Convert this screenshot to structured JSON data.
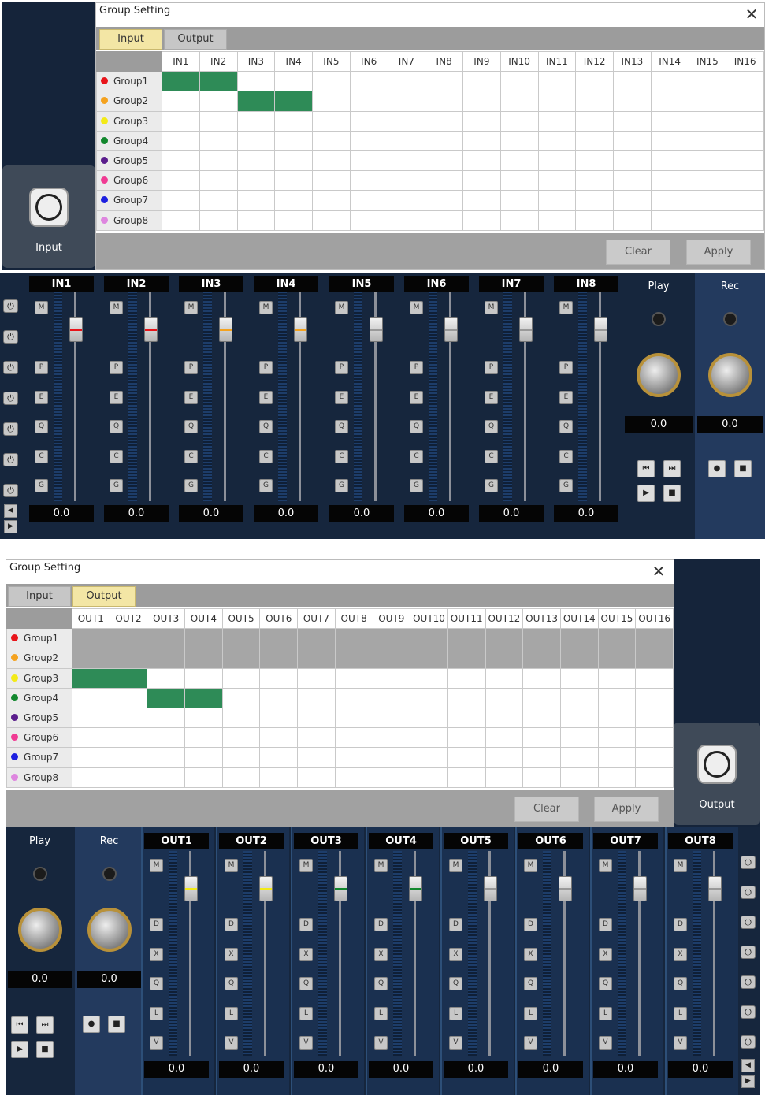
{
  "top": {
    "title": "Group Setting",
    "tabs": [
      "Input",
      "Output"
    ],
    "columns": [
      "IN1",
      "IN2",
      "IN3",
      "IN4",
      "IN5",
      "IN6",
      "IN7",
      "IN8",
      "IN9",
      "IN10",
      "IN11",
      "IN12",
      "IN13",
      "IN14",
      "IN15",
      "IN16"
    ],
    "groups": [
      {
        "name": "Group1",
        "color": "#e8141a"
      },
      {
        "name": "Group2",
        "color": "#f4a21f"
      },
      {
        "name": "Group3",
        "color": "#f3ea17"
      },
      {
        "name": "Group4",
        "color": "#12872d"
      },
      {
        "name": "Group5",
        "color": "#5a1d8c"
      },
      {
        "name": "Group6",
        "color": "#f03b93"
      },
      {
        "name": "Group7",
        "color": "#1d20e0"
      },
      {
        "name": "Group8",
        "color": "#de86df"
      }
    ],
    "active_cells": [
      [
        0,
        0
      ],
      [
        0,
        1
      ],
      [
        1,
        2
      ],
      [
        1,
        3
      ]
    ],
    "clear_label": "Clear",
    "apply_label": "Apply",
    "side_label": "Input",
    "strips": [
      {
        "name": "IN1",
        "value": "0.0",
        "marker": "#e8141a"
      },
      {
        "name": "IN2",
        "value": "0.0",
        "marker": "#e8141a"
      },
      {
        "name": "IN3",
        "value": "0.0",
        "marker": "#f4a21f"
      },
      {
        "name": "IN4",
        "value": "0.0",
        "marker": "#f4a21f"
      },
      {
        "name": "IN5",
        "value": "0.0",
        "marker": ""
      },
      {
        "name": "IN6",
        "value": "0.0",
        "marker": ""
      },
      {
        "name": "IN7",
        "value": "0.0",
        "marker": ""
      },
      {
        "name": "IN8",
        "value": "0.0",
        "marker": ""
      }
    ],
    "strip_buttons": [
      "M",
      "P",
      "E",
      "Q",
      "C",
      "G"
    ],
    "play": {
      "title": "Play",
      "value": "0.0"
    },
    "rec": {
      "title": "Rec",
      "value": "0.0"
    }
  },
  "bottom": {
    "title": "Group Setting",
    "tabs": [
      "Input",
      "Output"
    ],
    "columns": [
      "OUT1",
      "OUT2",
      "OUT3",
      "OUT4",
      "OUT5",
      "OUT6",
      "OUT7",
      "OUT8",
      "OUT9",
      "OUT10",
      "OUT11",
      "OUT12",
      "OUT13",
      "OUT14",
      "OUT15",
      "OUT16"
    ],
    "groups": [
      {
        "name": "Group1",
        "color": "#e8141a"
      },
      {
        "name": "Group2",
        "color": "#f4a21f"
      },
      {
        "name": "Group3",
        "color": "#f3ea17"
      },
      {
        "name": "Group4",
        "color": "#12872d"
      },
      {
        "name": "Group5",
        "color": "#5a1d8c"
      },
      {
        "name": "Group6",
        "color": "#f03b93"
      },
      {
        "name": "Group7",
        "color": "#1d20e0"
      },
      {
        "name": "Group8",
        "color": "#de86df"
      }
    ],
    "active_cells": [
      [
        2,
        0
      ],
      [
        2,
        1
      ],
      [
        3,
        2
      ],
      [
        3,
        3
      ]
    ],
    "disabled_rows": [
      0,
      1
    ],
    "clear_label": "Clear",
    "apply_label": "Apply",
    "side_label": "Output",
    "strips": [
      {
        "name": "OUT1",
        "value": "0.0",
        "marker": "#f3ea17"
      },
      {
        "name": "OUT2",
        "value": "0.0",
        "marker": "#f3ea17"
      },
      {
        "name": "OUT3",
        "value": "0.0",
        "marker": "#12872d"
      },
      {
        "name": "OUT4",
        "value": "0.0",
        "marker": "#12872d"
      },
      {
        "name": "OUT5",
        "value": "0.0",
        "marker": ""
      },
      {
        "name": "OUT6",
        "value": "0.0",
        "marker": ""
      },
      {
        "name": "OUT7",
        "value": "0.0",
        "marker": ""
      },
      {
        "name": "OUT8",
        "value": "0.0",
        "marker": ""
      }
    ],
    "strip_buttons": [
      "M",
      "D",
      "X",
      "Q",
      "L",
      "V"
    ],
    "play": {
      "title": "Play",
      "value": "0.0"
    },
    "rec": {
      "title": "Rec",
      "value": "0.0"
    }
  }
}
